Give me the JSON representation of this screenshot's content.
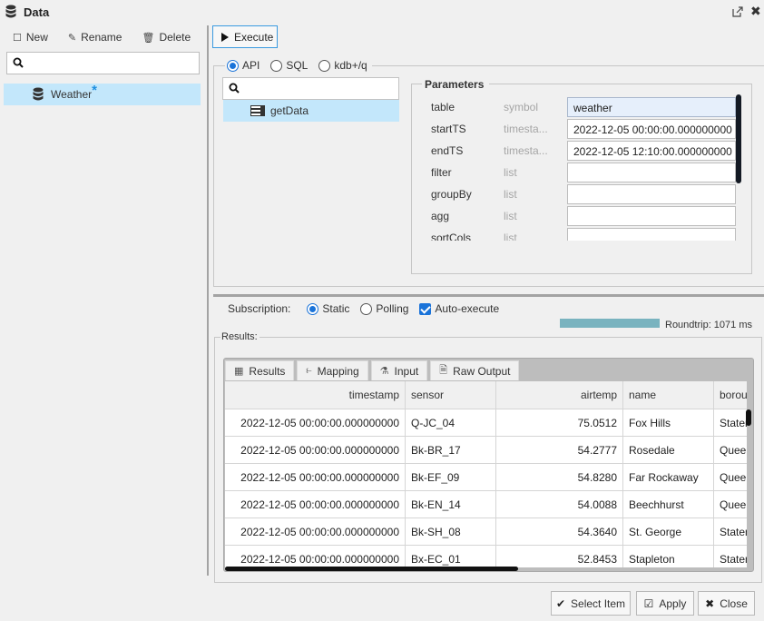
{
  "window": {
    "title": "Data",
    "popout_icon": "popout-icon",
    "close_icon": "close-icon"
  },
  "left_panel": {
    "toolbar": [
      {
        "label": "New",
        "icon": "☐",
        "icon_name": "new-icon"
      },
      {
        "label": "Rename",
        "icon": "✎",
        "icon_name": "rename-icon"
      },
      {
        "label": "Delete",
        "icon": "🗑",
        "icon_name": "trash-icon"
      }
    ],
    "search": {
      "value": "",
      "placeholder": ""
    },
    "tree": [
      {
        "label": "Weather",
        "modified_marker": "*",
        "selected": true
      }
    ]
  },
  "toolbar": {
    "execute_label": "Execute"
  },
  "query": {
    "modes": [
      {
        "label": "API",
        "selected": true
      },
      {
        "label": "SQL",
        "selected": false
      },
      {
        "label": "kdb+/q",
        "selected": false
      }
    ],
    "api_search": {
      "value": "",
      "placeholder": ""
    },
    "api_list": [
      {
        "label": "getData",
        "selected": true
      }
    ],
    "parameters": {
      "title": "Parameters",
      "rows": [
        {
          "name": "table",
          "type": "symbol",
          "value": "weather"
        },
        {
          "name": "startTS",
          "type": "timesta...",
          "value": "2022-12-05 00:00:00.000000000"
        },
        {
          "name": "endTS",
          "type": "timesta...",
          "value": "2022-12-05 12:10:00.000000000"
        },
        {
          "name": "filter",
          "type": "list",
          "value": ""
        },
        {
          "name": "groupBy",
          "type": "list",
          "value": ""
        },
        {
          "name": "agg",
          "type": "list",
          "value": ""
        },
        {
          "name": "sortCols",
          "type": "list",
          "value": ""
        }
      ]
    }
  },
  "subscription": {
    "label": "Subscription:",
    "options": [
      {
        "label": "Static",
        "selected": true
      },
      {
        "label": "Polling",
        "selected": false
      }
    ],
    "auto_execute": {
      "label": "Auto-execute",
      "checked": true
    },
    "progress_percent": 100,
    "progress_color": "#79b3bf",
    "roundtrip": "Roundtrip: 1071 ms"
  },
  "results": {
    "legend": "Results:",
    "tabs": [
      {
        "label": "Results",
        "icon": "▦",
        "icon_name": "table-icon"
      },
      {
        "label": "Mapping",
        "icon": "⥼",
        "icon_name": "mapping-icon"
      },
      {
        "label": "Input",
        "icon": "⚗",
        "icon_name": "flask-icon"
      },
      {
        "label": "Raw Output",
        "icon": "🗎",
        "icon_name": "document-icon"
      }
    ],
    "columns": [
      "timestamp",
      "sensor",
      "airtemp",
      "name",
      "boroug"
    ],
    "rows": [
      [
        "2022-12-05 00:00:00.000000000",
        "Q-JC_04",
        "75.0512",
        "Fox Hills",
        "Staten"
      ],
      [
        "2022-12-05 00:00:00.000000000",
        "Bk-BR_17",
        "54.2777",
        "Rosedale",
        "Queens"
      ],
      [
        "2022-12-05 00:00:00.000000000",
        "Bk-EF_09",
        "54.8280",
        "Far Rockaway",
        "Queens"
      ],
      [
        "2022-12-05 00:00:00.000000000",
        "Bk-EN_14",
        "54.0088",
        "Beechhurst",
        "Queens"
      ],
      [
        "2022-12-05 00:00:00.000000000",
        "Bk-SH_08",
        "54.3640",
        "St. George",
        "Staten"
      ],
      [
        "2022-12-05 00:00:00.000000000",
        "Bx-EC_01",
        "52.8453",
        "Stapleton",
        "Staten"
      ]
    ]
  },
  "footer": {
    "select_item": "Select Item",
    "apply": "Apply",
    "close": "Close"
  }
}
